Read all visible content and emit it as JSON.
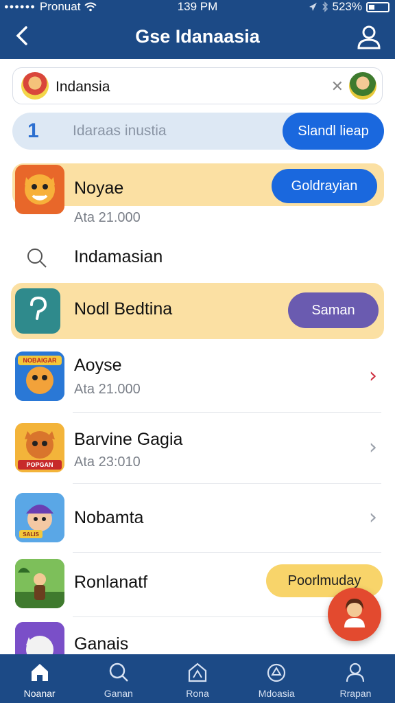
{
  "status_bar": {
    "carrier": "Pronuat",
    "time": "139 PM",
    "battery": "523%"
  },
  "header": {
    "title": "Gse Idanaasia"
  },
  "search": {
    "value": "Indansia"
  },
  "filter": {
    "number": "1",
    "placeholder": "Idaraas inustia",
    "button": "Slandl lieap"
  },
  "rows": [
    {
      "name": "Noyae",
      "sub": "Ata 21.000",
      "button": "Goldrayian"
    },
    {
      "name": "Indamasian"
    },
    {
      "name": "Nodl Bedtina",
      "button": "Saman"
    },
    {
      "name": "Aoyse",
      "sub": "Ata 21.000"
    },
    {
      "name": "Barvine Gagia",
      "sub": "Ata 23:010"
    },
    {
      "name": "Nobamta"
    },
    {
      "name": "Ronlanatf",
      "button": "Poorlmuday"
    },
    {
      "name": "Ganais"
    }
  ],
  "icon_labels": {
    "app4": "NOBAIGAR",
    "app5": "POPGAN",
    "app6": "SALIS"
  },
  "nav": [
    {
      "label": "Noanar",
      "icon": "home-icon"
    },
    {
      "label": "Ganan",
      "icon": "search-icon"
    },
    {
      "label": "Rona",
      "icon": "map-icon"
    },
    {
      "label": "Mdoasia",
      "icon": "discover-icon"
    },
    {
      "label": "Rrapan",
      "icon": "profile-icon"
    }
  ],
  "colors": {
    "header": "#1c4a86",
    "primary_button": "#1a68de",
    "highlight": "#fbe0a3",
    "purple_button": "#6a5bb0",
    "yellow_button": "#f8d46a",
    "fab": "#e34a2f",
    "chevron_alert": "#cf3142"
  }
}
